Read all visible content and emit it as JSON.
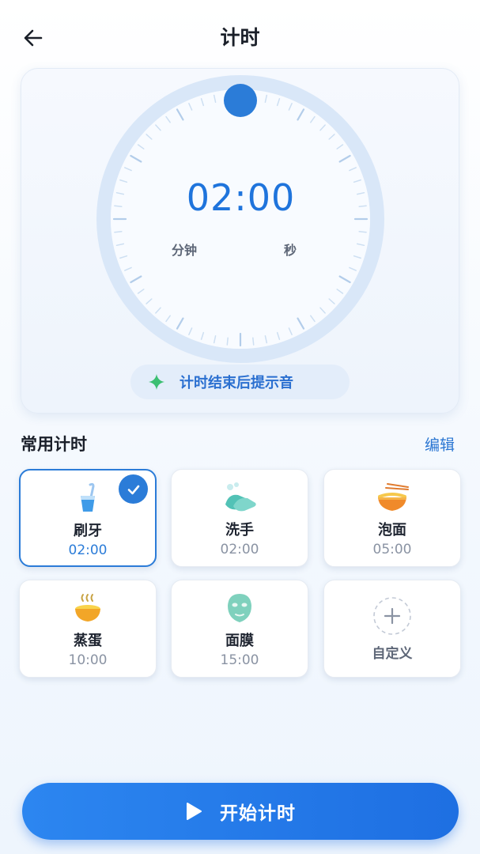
{
  "header": {
    "title": "计时",
    "back_icon": "arrow-left-icon"
  },
  "timer": {
    "time": "02:00",
    "minutes_unit": "分钟",
    "seconds_unit": "秒",
    "accent_color": "#1f74dc"
  },
  "sound": {
    "label": "计时结束后提示音",
    "icon": "sparkle-icon",
    "icon_color": "#3cbf72"
  },
  "presets_section": {
    "title": "常用计时",
    "edit_label": "编辑"
  },
  "presets": [
    {
      "name": "刷牙",
      "duration": "02:00",
      "icon": "toothbrush-cup-icon",
      "selected": true
    },
    {
      "name": "洗手",
      "duration": "02:00",
      "icon": "washing-hands-icon",
      "selected": false
    },
    {
      "name": "泡面",
      "duration": "05:00",
      "icon": "noodle-bowl-icon",
      "selected": false
    },
    {
      "name": "蒸蛋",
      "duration": "10:00",
      "icon": "steamed-egg-icon",
      "selected": false
    },
    {
      "name": "面膜",
      "duration": "15:00",
      "icon": "face-mask-icon",
      "selected": false
    }
  ],
  "custom_preset": {
    "label": "自定义",
    "icon": "plus-icon"
  },
  "start_button": {
    "label": "开始计时",
    "icon": "play-icon",
    "color": "#2278e6"
  }
}
